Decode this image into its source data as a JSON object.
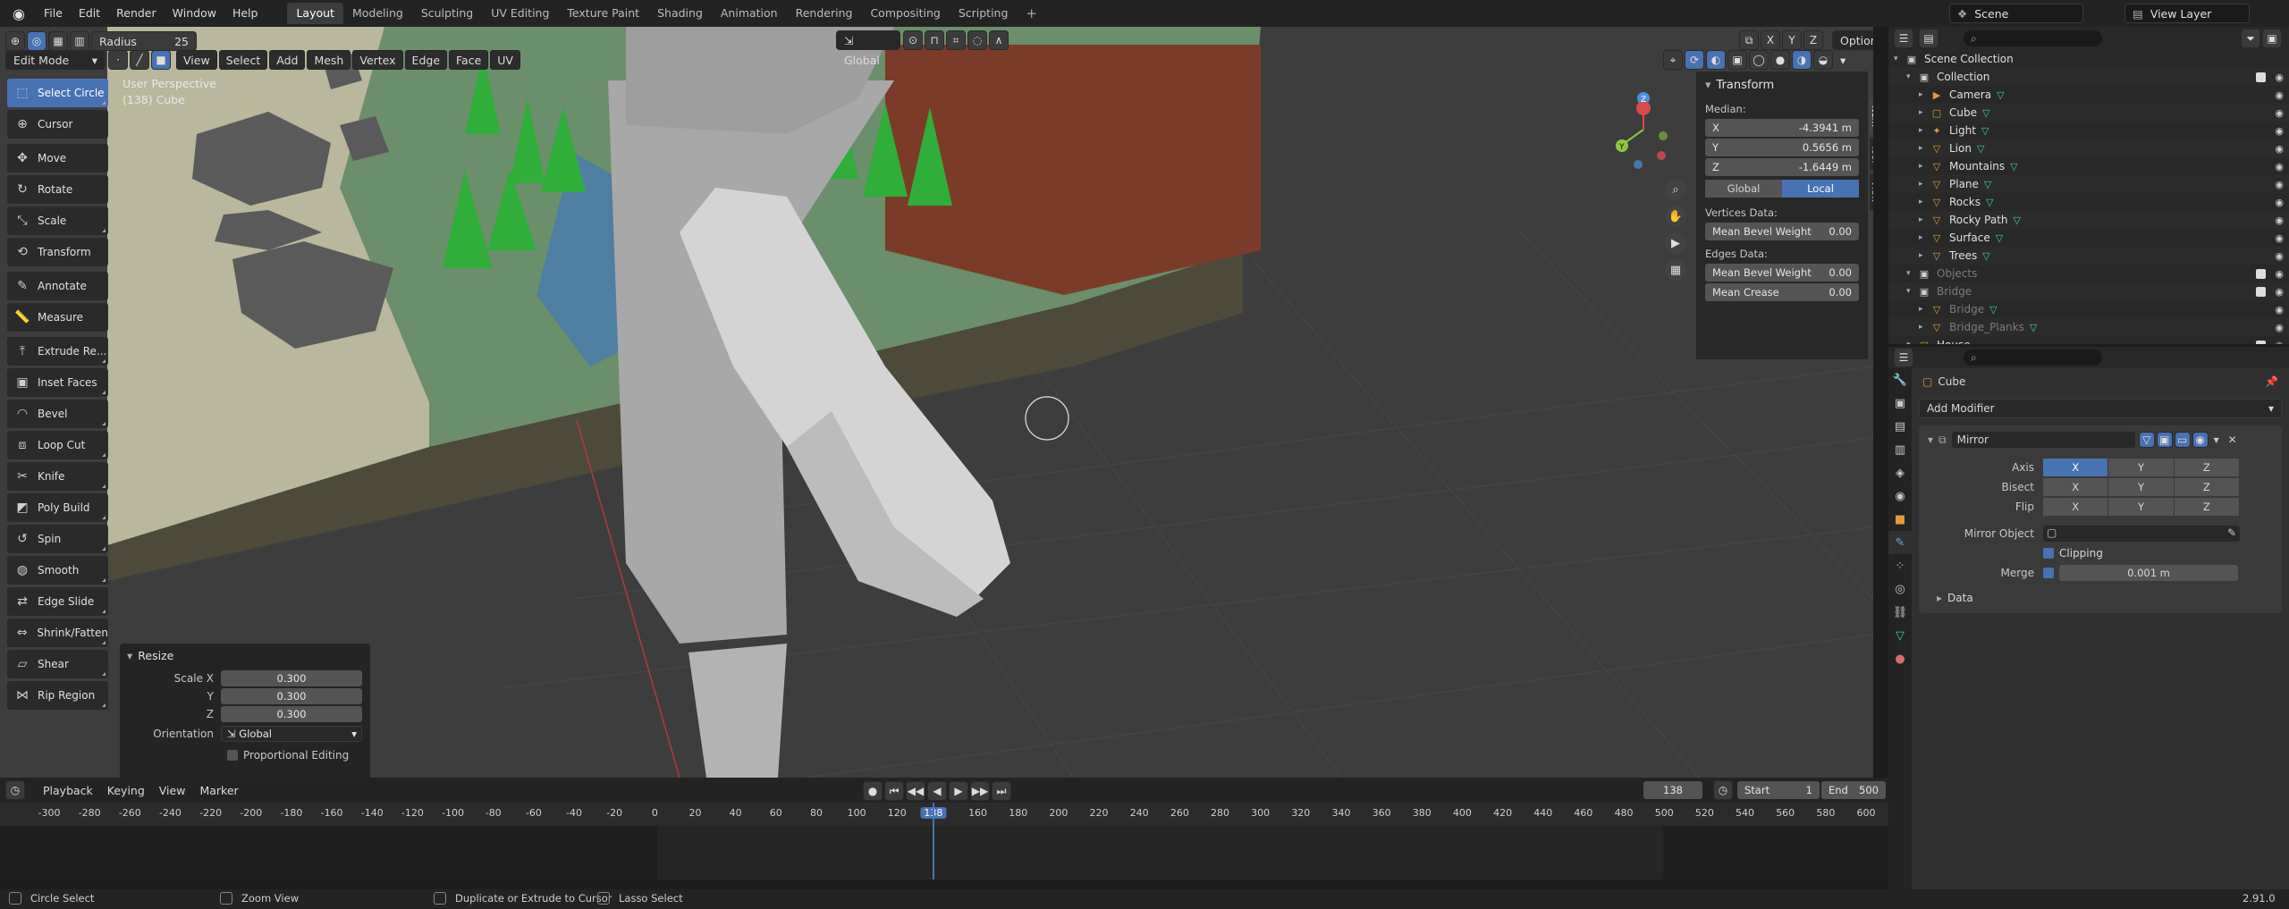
{
  "menu": [
    "File",
    "Edit",
    "Render",
    "Window",
    "Help"
  ],
  "workspaces": [
    "Layout",
    "Modeling",
    "Sculpting",
    "UV Editing",
    "Texture Paint",
    "Shading",
    "Animation",
    "Rendering",
    "Compositing",
    "Scripting"
  ],
  "active_workspace": "Layout",
  "tool_settings": {
    "radius_label": "Radius",
    "radius_value": "25",
    "orientation": "Global",
    "options": "Options"
  },
  "scene": {
    "name": "Scene",
    "view_layer": "View Layer"
  },
  "viewport_header": {
    "mode": "Edit Mode",
    "menus": [
      "View",
      "Select",
      "Add",
      "Mesh",
      "Vertex",
      "Edge",
      "Face",
      "UV"
    ]
  },
  "overlay": {
    "perspective": "User Perspective",
    "object": "(138) Cube"
  },
  "tools": [
    "Select Circle",
    "Cursor",
    "Move",
    "Rotate",
    "Scale",
    "Transform",
    "Annotate",
    "Measure",
    "Extrude Re...",
    "Inset Faces",
    "Bevel",
    "Loop Cut",
    "Knife",
    "Poly Build",
    "Spin",
    "Smooth",
    "Edge Slide",
    "Shrink/Fatten",
    "Shear",
    "Rip Region"
  ],
  "resize_panel": {
    "title": "Resize",
    "scale_x_label": "Scale X",
    "scale_x": "0.300",
    "y_label": "Y",
    "y": "0.300",
    "z_label": "Z",
    "z": "0.300",
    "orientation_label": "Orientation",
    "orientation": "Global",
    "proportional": "Proportional Editing"
  },
  "transform_panel": {
    "title": "Transform",
    "median_label": "Median:",
    "x_label": "X",
    "x": "-4.3941 m",
    "y_label": "Y",
    "y": "0.5656 m",
    "z_label": "Z",
    "z": "-1.6449 m",
    "global": "Global",
    "local": "Local",
    "vertices_data": "Vertices Data:",
    "mean_bevel_weight": "Mean Bevel Weight",
    "vert_bevel_value": "0.00",
    "edges_data": "Edges Data:",
    "edge_bevel_value": "0.00",
    "mean_crease": "Mean Crease",
    "crease_value": "0.00"
  },
  "side_tabs": [
    "Item",
    "Tool",
    "View"
  ],
  "gizmo": {
    "x": "X",
    "y": "Y",
    "z": "Z"
  },
  "timeline": {
    "menus": [
      "Playback",
      "Keying",
      "View",
      "Marker"
    ],
    "current_frame": "138",
    "start_label": "Start",
    "start": "1",
    "end_label": "End",
    "end": "500",
    "ticks": [
      "-300",
      "-280",
      "-260",
      "-240",
      "-220",
      "-200",
      "-180",
      "-160",
      "-140",
      "-120",
      "-100",
      "-80",
      "-60",
      "-40",
      "-20",
      "0",
      "20",
      "40",
      "60",
      "80",
      "100",
      "120",
      "138",
      "160",
      "180",
      "200",
      "220",
      "240",
      "260",
      "280",
      "300",
      "320",
      "340",
      "360",
      "380",
      "400",
      "420",
      "440",
      "460",
      "480",
      "500",
      "520",
      "540",
      "560",
      "580",
      "600"
    ]
  },
  "status": {
    "left": "Circle Select",
    "middle": "Zoom View",
    "right1": "Duplicate or Extrude to Cursor",
    "right2": "Lasso Select",
    "version": "2.91.0"
  },
  "outliner": {
    "items": [
      {
        "name": "Scene Collection",
        "indent": 0,
        "icon": "▣",
        "dim": false
      },
      {
        "name": "Collection",
        "indent": 1,
        "icon": "▣",
        "dim": false
      },
      {
        "name": "Camera",
        "indent": 2,
        "icon": "▶",
        "dim": false
      },
      {
        "name": "Cube",
        "indent": 2,
        "icon": "▢",
        "dim": false
      },
      {
        "name": "Light",
        "indent": 2,
        "icon": "✦",
        "dim": false
      },
      {
        "name": "Lion",
        "indent": 2,
        "icon": "▽",
        "dim": false
      },
      {
        "name": "Mountains",
        "indent": 2,
        "icon": "▽",
        "dim": false
      },
      {
        "name": "Plane",
        "indent": 2,
        "icon": "▽",
        "dim": false
      },
      {
        "name": "Rocks",
        "indent": 2,
        "icon": "▽",
        "dim": false
      },
      {
        "name": "Rocky Path",
        "indent": 2,
        "icon": "▽",
        "dim": false
      },
      {
        "name": "Surface",
        "indent": 2,
        "icon": "▽",
        "dim": false
      },
      {
        "name": "Trees",
        "indent": 2,
        "icon": "▽",
        "dim": false
      },
      {
        "name": "Objects",
        "indent": 1,
        "icon": "▣",
        "dim": true
      },
      {
        "name": "Bridge",
        "indent": 1,
        "icon": "▣",
        "dim": true
      },
      {
        "name": "Bridge",
        "indent": 2,
        "icon": "▽",
        "dim": true
      },
      {
        "name": "Bridge_Planks",
        "indent": 2,
        "icon": "▽",
        "dim": true
      },
      {
        "name": "House",
        "indent": 1,
        "icon": "▽",
        "dim": false
      }
    ]
  },
  "properties": {
    "object": "Cube",
    "add_modifier": "Add Modifier",
    "modifier_name": "Mirror",
    "axis_label": "Axis",
    "bisect_label": "Bisect",
    "flip_label": "Flip",
    "x": "X",
    "y": "Y",
    "z": "Z",
    "mirror_object_label": "Mirror Object",
    "clipping": "Clipping",
    "merge_label": "Merge",
    "merge_value": "0.001 m",
    "data_label": "Data"
  }
}
